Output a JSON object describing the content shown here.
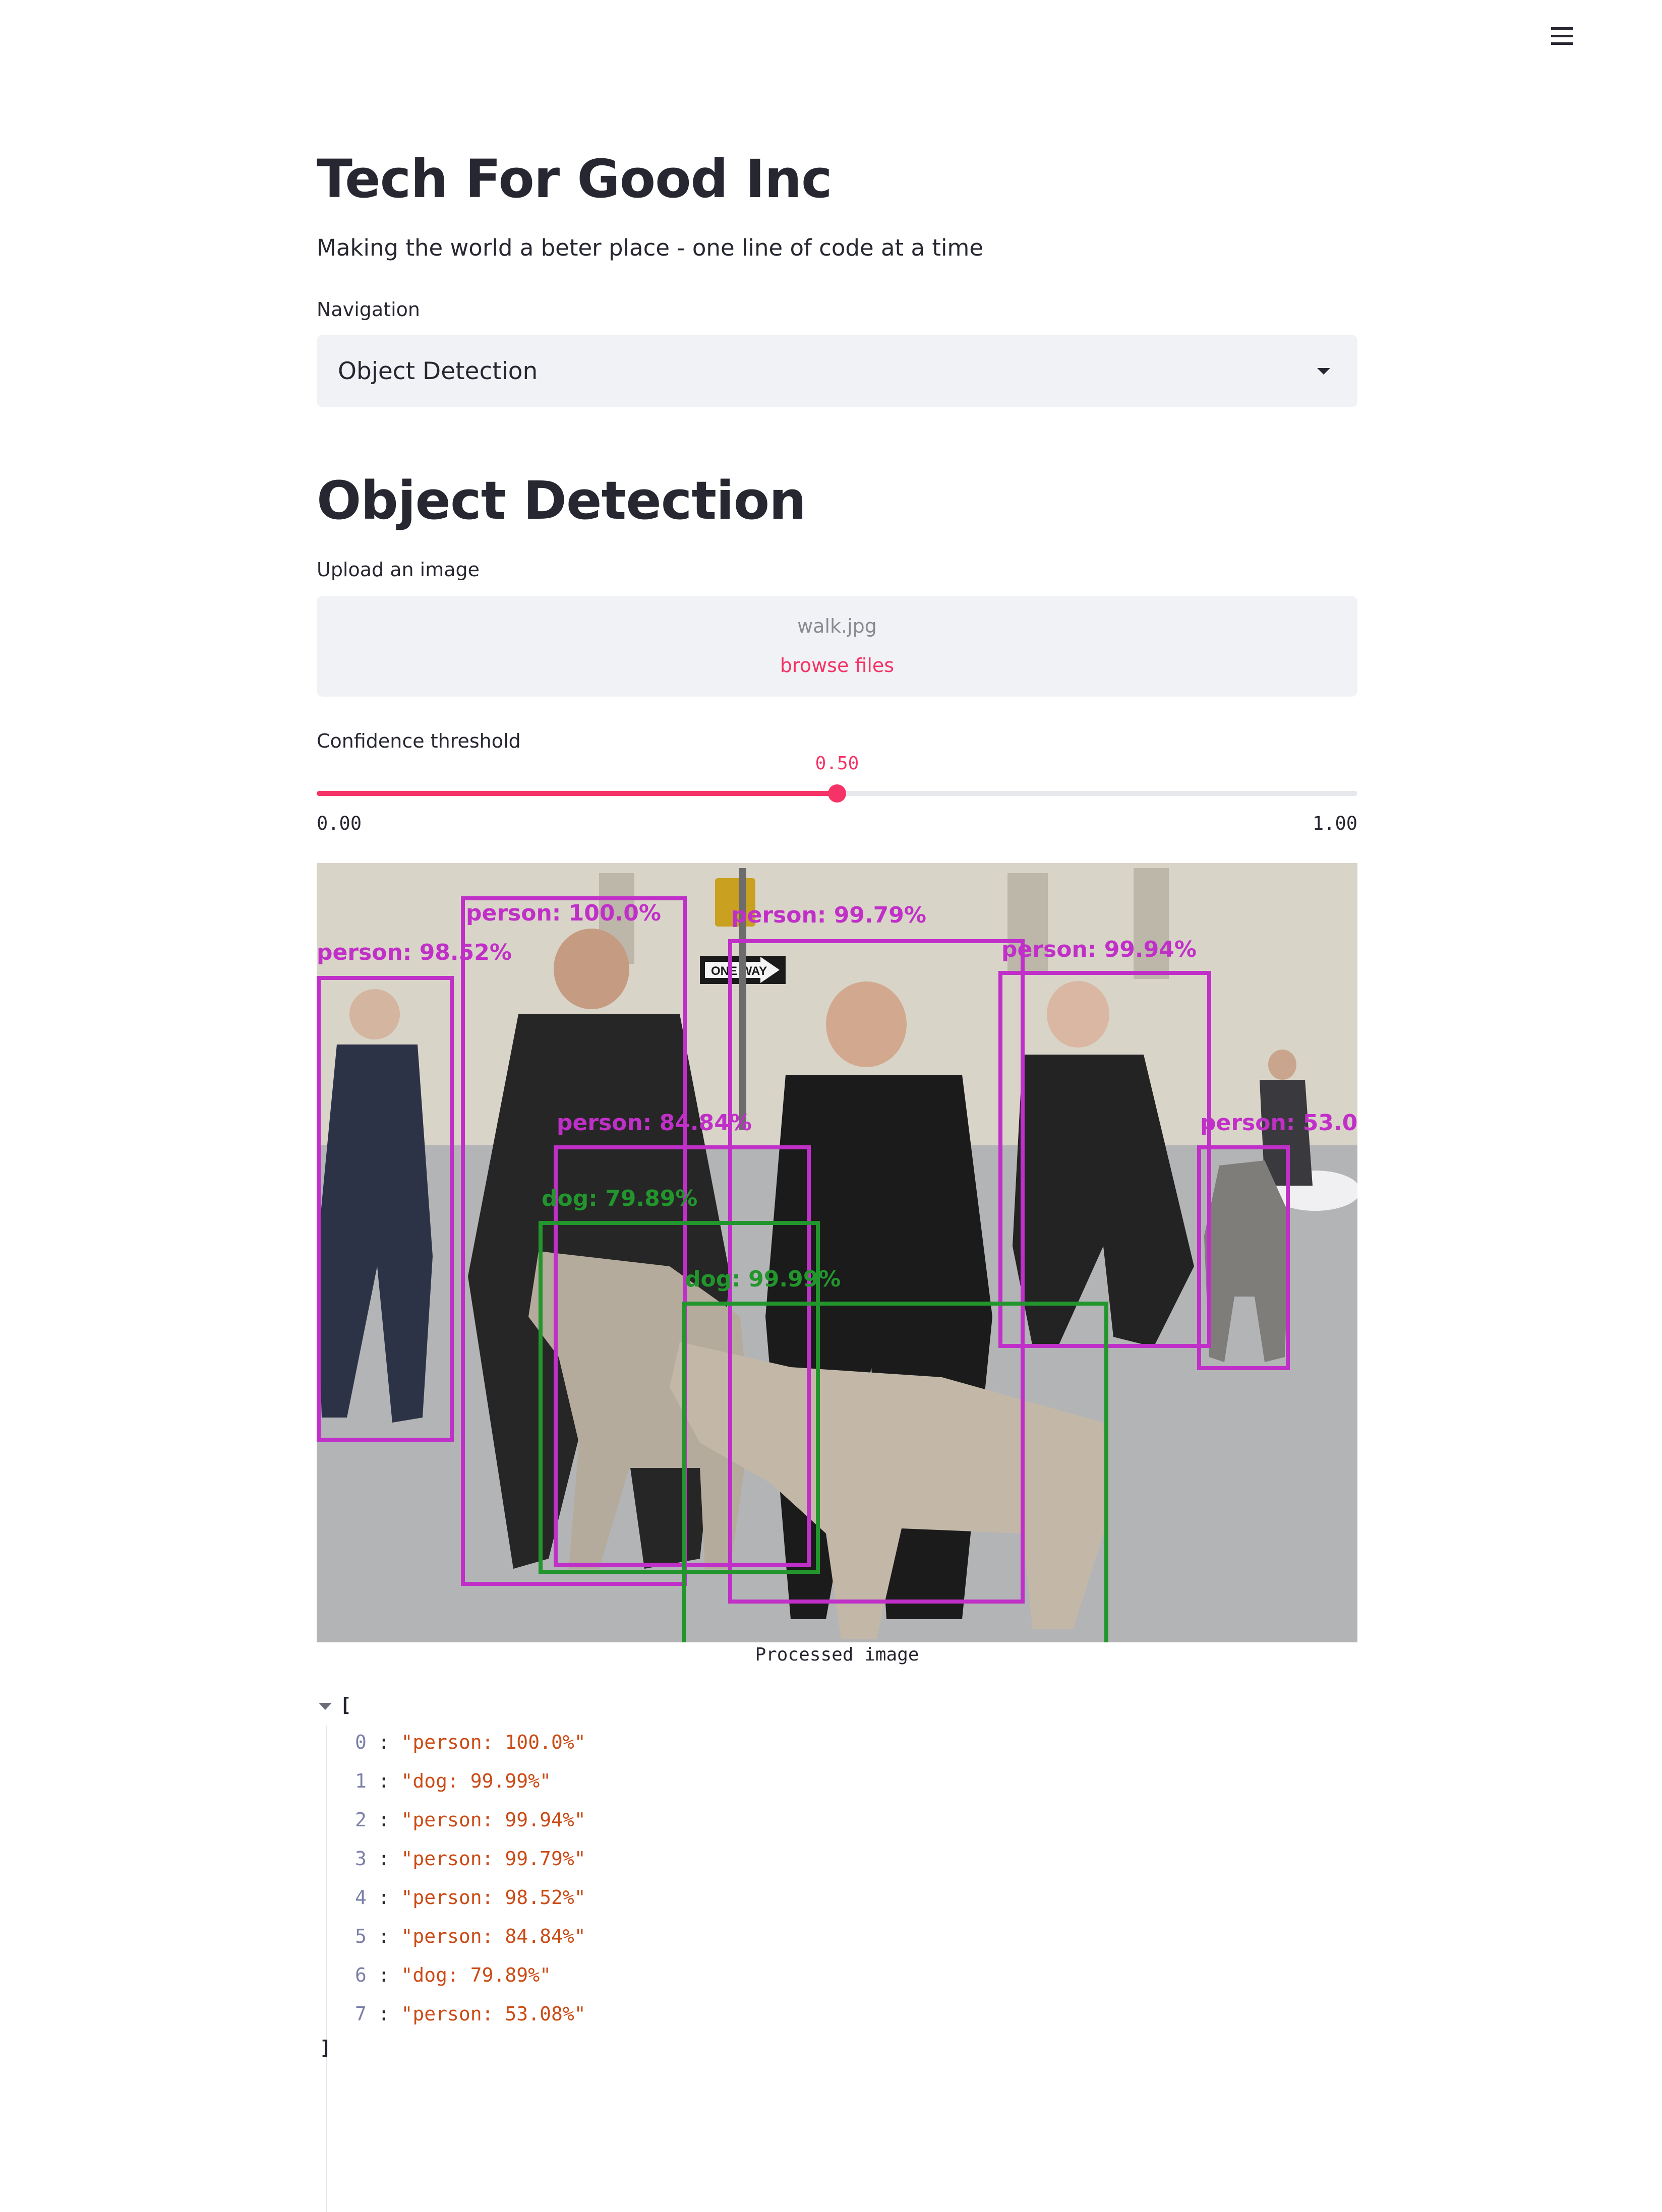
{
  "header": {
    "menu_icon": "hamburger-menu-icon"
  },
  "app": {
    "title": "Tech For Good Inc",
    "subtitle": "Making the world a beter place - one line of code at a time"
  },
  "navigation": {
    "label": "Navigation",
    "selected": "Object Detection"
  },
  "section": {
    "title": "Object Detection"
  },
  "uploader": {
    "label": "Upload an image",
    "file_name": "walk.jpg",
    "browse_label": "browse files"
  },
  "slider": {
    "label": "Confidence threshold",
    "value": 0.5,
    "value_label": "0.50",
    "min_label": "0.00",
    "max_label": "1.00"
  },
  "image": {
    "caption": "Processed image",
    "box_colors": {
      "person": "#c030c8",
      "dog": "#22962c"
    },
    "detections": [
      {
        "label": "person: 100.0%"
      },
      {
        "label": "person: 99.79%"
      },
      {
        "label": "person: 98.52%"
      },
      {
        "label": "person: 99.94%"
      },
      {
        "label": "person: 84.84%"
      },
      {
        "label": "person: 53.08%"
      },
      {
        "label": "dog: 79.89%"
      },
      {
        "label": "dog: 99.99%"
      }
    ],
    "sign_text": "ONE WAY"
  },
  "results": {
    "open_bracket": "[",
    "close_bracket": "]",
    "items": [
      {
        "index": "0",
        "value": "\"person: 100.0%\""
      },
      {
        "index": "1",
        "value": "\"dog: 99.99%\""
      },
      {
        "index": "2",
        "value": "\"person: 99.94%\""
      },
      {
        "index": "3",
        "value": "\"person: 99.79%\""
      },
      {
        "index": "4",
        "value": "\"person: 98.52%\""
      },
      {
        "index": "5",
        "value": "\"person: 84.84%\""
      },
      {
        "index": "6",
        "value": "\"dog: 79.89%\""
      },
      {
        "index": "7",
        "value": "\"person: 53.08%\""
      }
    ]
  }
}
